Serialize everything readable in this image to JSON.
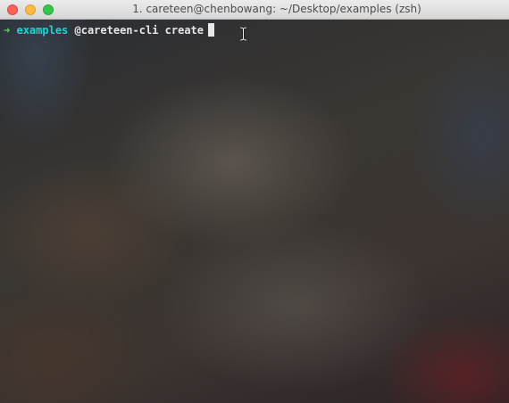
{
  "window": {
    "title": "1. careteen@chenbowang: ~/Desktop/examples (zsh)",
    "controls": [
      "close",
      "minimize",
      "zoom"
    ]
  },
  "terminal": {
    "prompt_symbol": "➜",
    "cwd": "examples",
    "command": "@careteen-cli create",
    "colors": {
      "prompt_arrow": "#5fd75f",
      "cwd": "#1fd3d3",
      "command": "#e6e6e6"
    },
    "icons": {
      "text_cursor": "i-beam-icon"
    }
  }
}
